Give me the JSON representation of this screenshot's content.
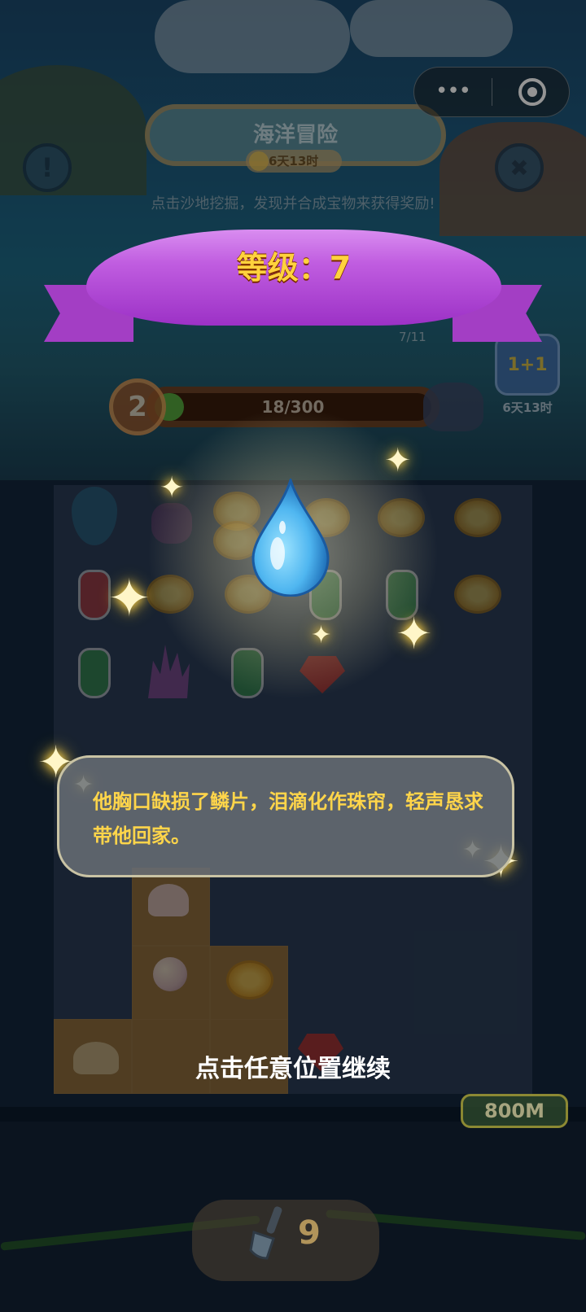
{
  "header": {
    "title": "海洋冒险",
    "timer": "6天13时",
    "hint": "点击沙地挖掘，发现并合成宝物来获得奖励!"
  },
  "buttons": {
    "info_label": "!",
    "close_label": "✖"
  },
  "level": {
    "label": "等级：7"
  },
  "progress": {
    "badge": "2",
    "text": "18/300",
    "fraction": 0.06,
    "sub_count": "7/11"
  },
  "bonus": {
    "label": "1+1",
    "timer": "6天13时"
  },
  "dialog": {
    "text": "他胸口缺损了鳞片，泪滴化作珠帘，轻声恳求带他回家。"
  },
  "continue_hint": "点击任意位置继续",
  "distance": "800M",
  "shovel": {
    "count": "9"
  },
  "capsule": {
    "more_icon": "ellipsis-icon",
    "close_icon": "target-icon",
    "dots": "•••"
  },
  "colors": {
    "ribbon": "#c05de0",
    "level_text": "#ffd23d",
    "dialog_text": "#ffd54a",
    "drop": "#4fb6f0"
  }
}
